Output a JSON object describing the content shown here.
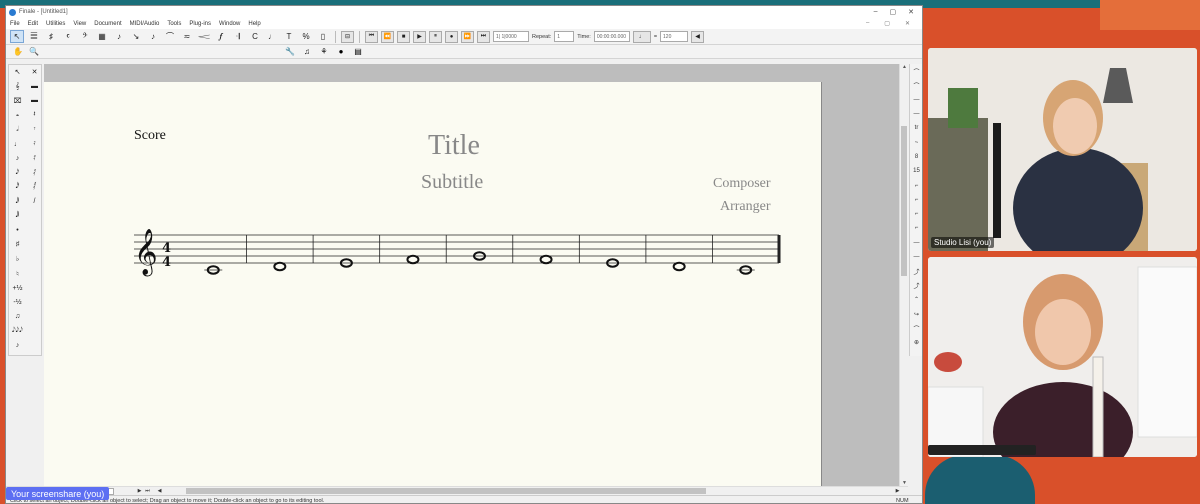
{
  "app": {
    "window_title": "Finale - [Untitled1]",
    "window_controls": [
      "–",
      "▢",
      "✕"
    ],
    "mdi_controls": [
      "–",
      "▢",
      "✕"
    ],
    "menus": [
      "File",
      "Edit",
      "Utilities",
      "View",
      "Document",
      "MIDI/Audio",
      "Tools",
      "Plug-ins",
      "Window",
      "Help"
    ]
  },
  "toolbar": {
    "counter": "1| 1|0000",
    "repeat_label": "Repeat:",
    "repeat_value": "1",
    "time_label": "Time:",
    "time_value": "00:00:00.000",
    "tempo_eq": "=",
    "tempo_value": "120"
  },
  "score": {
    "score_label": "Score",
    "title": "Title",
    "subtitle": "Subtitle",
    "composer": "Composer",
    "arranger": "Arranger"
  },
  "left_palette": {
    "col1": [
      "↖",
      "𝄞",
      "⌧",
      "𝅝",
      "𝅗𝅥",
      "♩",
      "♪",
      "𝅘𝅥𝅯",
      "𝅘𝅥𝅰",
      "𝅘𝅥𝅱",
      "𝅘𝅥𝅲",
      "•",
      "♯",
      "♭",
      "♮",
      "+½",
      "-½",
      "♫",
      "𝅘𝅥𝅮𝅘𝅥𝅮𝅘𝅥𝅮",
      "♪"
    ],
    "col2": [
      "✕",
      "▬",
      "▬",
      "𝄽",
      "𝄾",
      "𝄿",
      "𝅀",
      "𝅁",
      "𝅂",
      "/"
    ]
  },
  "right_palette": [
    "⌒",
    "⌒",
    "—",
    "—",
    "tr",
    "~",
    "8",
    "15",
    "⌐",
    "⌐",
    "⌐",
    "⌐",
    "—",
    "—",
    "⤴",
    "⤴",
    "⌃",
    "↪",
    "⌒",
    "⊕"
  ],
  "status": {
    "hint": "Click to select an object; Double-click an object to select; Drag an object to move it; Double-click an object to go to its editing tool.",
    "num": "NUM"
  },
  "share_badge": "Your screenshare (you)",
  "participants": [
    {
      "name": "Studio Lisi (you)"
    },
    {
      "name": ""
    }
  ],
  "music": {
    "clef": "𝄞",
    "time_sig_top": "4",
    "time_sig_bottom": "4",
    "measures": 9,
    "notes": [
      "C4",
      "D4",
      "E4",
      "F4",
      "G4",
      "F4",
      "E4",
      "D4",
      "C4"
    ]
  }
}
